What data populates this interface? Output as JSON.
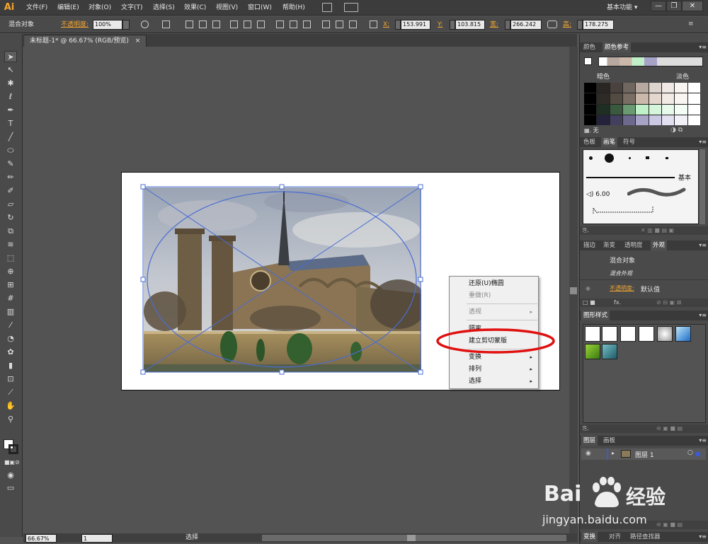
{
  "app": {
    "logo": "Ai",
    "menus": [
      "文件(F)",
      "编辑(E)",
      "对象(O)",
      "文字(T)",
      "选择(S)",
      "效果(C)",
      "视图(V)",
      "窗口(W)",
      "帮助(H)"
    ],
    "workspace": "基本功能",
    "workspace_arrow": "▾",
    "win_minimize": "—",
    "win_restore": "❐",
    "win_close": "✕"
  },
  "controlbar": {
    "selection_label": "混合对象",
    "opacity_label": "不透明度:",
    "opacity_value": "100%",
    "x_label": "X:",
    "x_value": "153.991",
    "y_label": "Y:",
    "y_value": "103.815",
    "w_label": "宽:",
    "w_value": "266.242",
    "h_label": "高:",
    "h_value": "178.275"
  },
  "document": {
    "tab_title": "未标题-1* @ 66.67% (RGB/预览)",
    "tab_close": "×"
  },
  "context_menu": {
    "items": [
      {
        "label": "还原(U)椭圆",
        "enabled": true,
        "submenu": false
      },
      {
        "label": "重做(R)",
        "enabled": false,
        "submenu": false
      },
      {
        "label": "透视",
        "enabled": false,
        "submenu": true
      },
      {
        "label": "隔离",
        "enabled": true,
        "submenu": false
      },
      {
        "label": "建立剪切蒙版",
        "enabled": true,
        "submenu": false,
        "highlighted": true
      },
      {
        "label": "变换",
        "enabled": true,
        "submenu": true
      },
      {
        "label": "排列",
        "enabled": true,
        "submenu": true
      },
      {
        "label": "选择",
        "enabled": true,
        "submenu": true
      }
    ],
    "submenu_arrow": "▸"
  },
  "panels": {
    "color_tabs": [
      "颜色",
      "颜色参考"
    ],
    "dark_label": "暗色",
    "light_label": "淡色",
    "none_label": "无",
    "brush_tabs": [
      "色板",
      "画笔",
      "符号"
    ],
    "brush_basic": "基本",
    "brush_size": "6.00",
    "appearance_tabs": [
      "描边",
      "渐变",
      "透明度",
      "外观"
    ],
    "appearance_title": "混合对象",
    "appearance_sub": "混合外观",
    "appearance_opacity_label": "不透明度:",
    "appearance_opacity_value": "默认值",
    "graphic_styles_tab": "图形样式",
    "layers_tabs": [
      "图层",
      "画板"
    ],
    "layer_name": "图层 1",
    "bottom_tabs": [
      "变换",
      "对齐",
      "路径查找器"
    ],
    "fx_label": "fx."
  },
  "status": {
    "zoom": "66.67%",
    "page": "1",
    "tool": "选择"
  },
  "watermark": {
    "brand_left": "Bai",
    "brand_right": "经验",
    "url": "jingyan.baidu.com"
  },
  "colors": {
    "accent_orange": "#f4a630",
    "selection_blue": "#4a6cd4",
    "highlight_red": "#e01010"
  }
}
